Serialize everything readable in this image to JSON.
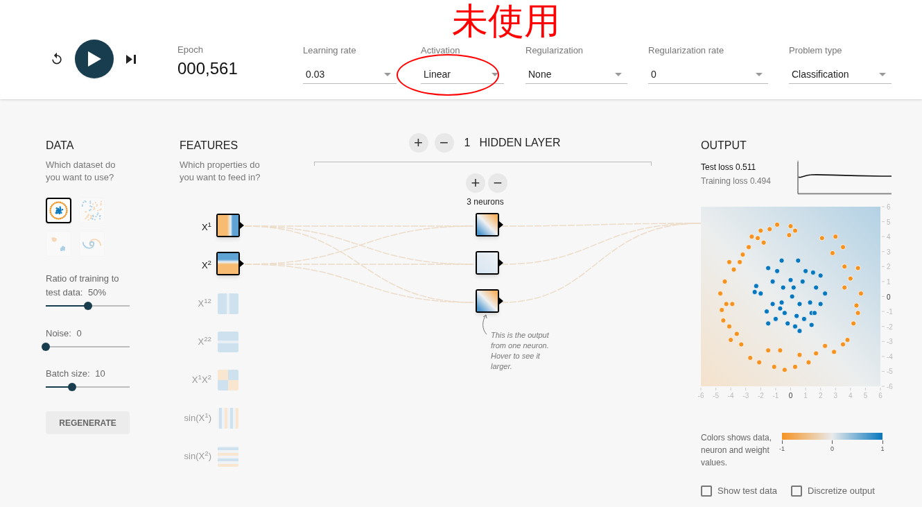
{
  "annotation": {
    "text": "未使用"
  },
  "controls": {
    "buttons": [
      {
        "kind": "reset"
      },
      {
        "kind": "play"
      },
      {
        "kind": "step"
      }
    ]
  },
  "epoch": {
    "label": "Epoch",
    "value": "000,561"
  },
  "dropdowns": [
    {
      "label": "Learning rate",
      "value": "0.03",
      "circled": false
    },
    {
      "label": "Activation",
      "value": "Linear",
      "circled": true
    },
    {
      "label": "Regularization",
      "value": "None",
      "circled": false
    },
    {
      "label": "Regularization rate",
      "value": "0",
      "circled": false
    },
    {
      "label": "Problem type",
      "value": "Classification",
      "circled": false
    }
  ],
  "data": {
    "title": "DATA",
    "description": "Which dataset do you want to use?",
    "datasets": [
      {
        "kind": "circle",
        "selected": true
      },
      {
        "kind": "xor",
        "selected": false
      },
      {
        "kind": "gauss",
        "selected": false
      },
      {
        "kind": "spiral",
        "selected": false
      }
    ],
    "sliders": [
      {
        "label": "Ratio of training to test data:",
        "value": "50%",
        "level": 0.5
      },
      {
        "label": "Noise:",
        "value": "0",
        "level": 0
      },
      {
        "label": "Batch size:",
        "value": "10",
        "level": 0.31
      }
    ],
    "regenerate": "REGENERATE"
  },
  "features": {
    "title": "FEATURES",
    "description": "Which properties do you want to feed in?",
    "items": [
      {
        "label": "X$^{1}$",
        "kind": "x1",
        "active": true
      },
      {
        "label": "X$^{2}$",
        "kind": "x2",
        "active": true
      },
      {
        "label": "X$^{12}$",
        "kind": "x1sq",
        "active": false
      },
      {
        "label": "X$^{22}$",
        "kind": "x2sq",
        "active": false
      },
      {
        "label": "X$^{1}$X$^{2}$",
        "kind": "x1x2",
        "active": false
      },
      {
        "label": "sin(X$^{1}$)",
        "kind": "sin1",
        "active": false
      },
      {
        "label": "sin(X$^{2}$)",
        "kind": "sin2",
        "active": false
      }
    ]
  },
  "hidden_layers": {
    "add": "+",
    "remove": "−",
    "count": "1",
    "title": "HIDDEN LAYER",
    "layer": {
      "add": "+",
      "remove": "−",
      "label": "3 neurons",
      "neurons": [
        {
          "kind": "diagonal"
        },
        {
          "kind": "faint"
        },
        {
          "kind": "diagonal"
        }
      ]
    },
    "callout": "This is the output from one neuron. Hover to see it larger."
  },
  "output": {
    "title": "OUTPUT",
    "test_loss": "Test loss 0.511",
    "training_loss": "Training loss 0.494",
    "chart_data": {
      "type": "scatter",
      "xlim": [
        -6,
        6
      ],
      "ylim": [
        -6,
        6
      ],
      "xticks": [
        {
          "value": -6,
          "label": "-6"
        },
        {
          "value": -5,
          "label": "-5"
        },
        {
          "value": -4,
          "label": "-4"
        },
        {
          "value": -3,
          "label": "-3"
        },
        {
          "value": -2,
          "label": "-2"
        },
        {
          "value": -1,
          "label": "-1"
        },
        {
          "value": 0,
          "label": "0"
        },
        {
          "value": 1,
          "label": "1"
        },
        {
          "value": 2,
          "label": "2"
        },
        {
          "value": 3,
          "label": "3"
        },
        {
          "value": 4,
          "label": "4"
        },
        {
          "value": 5,
          "label": "5"
        },
        {
          "value": 6,
          "label": "6"
        }
      ],
      "yticks": [
        {
          "value": -6,
          "label": "-6"
        },
        {
          "value": -5,
          "label": "-5"
        },
        {
          "value": -4,
          "label": "-4"
        },
        {
          "value": -3,
          "label": "-3"
        },
        {
          "value": -2,
          "label": "-2"
        },
        {
          "value": -1,
          "label": "-1"
        },
        {
          "value": 0,
          "label": "0"
        },
        {
          "value": 1,
          "label": "1"
        },
        {
          "value": 2,
          "label": "2"
        },
        {
          "value": 3,
          "label": "3"
        },
        {
          "value": 4,
          "label": "4"
        },
        {
          "value": 5,
          "label": "5"
        },
        {
          "value": 6,
          "label": "6"
        }
      ],
      "series": [
        {
          "color": "#f59322",
          "x": [
            -4.7,
            -4.6,
            -4.4,
            -4.1,
            -3.8,
            -3.4,
            -3.2,
            -2.8,
            -2.6,
            -2.2,
            -2.0,
            -1.8,
            -1.4,
            -0.9,
            0,
            0.3,
            -0.1,
            0.6,
            2.1,
            3.0,
            2.8,
            3.5,
            3.6,
            4.0,
            4.5,
            4.7,
            4.4,
            4.5,
            4.2,
            3.8,
            3.5,
            2.9,
            2.3,
            1.2,
            0.3,
            -0.4,
            -1.1,
            -2.1,
            -2.7,
            -3.3,
            -3.6,
            -4.0,
            -4.1,
            -4.5,
            -3.9,
            -4.3,
            3.6,
            1.7,
            -1.5,
            -0.7
          ],
          "values": [
            0.2,
            -0.9,
            1.0,
            2.3,
            1.8,
            2.3,
            2.8,
            3.3,
            4.0,
            3.9,
            4.4,
            3.6,
            4.5,
            4.8,
            4.7,
            4.4,
            4.1,
            -3.9,
            3.9,
            4.0,
            2.9,
            3.3,
            2.0,
            1.2,
            1.9,
            0.2,
            -0.6,
            -1.1,
            -1.8,
            -2.9,
            -3.2,
            -3.7,
            -3.3,
            -4.4,
            -4.7,
            -4.9,
            -4.7,
            -4.4,
            -4.1,
            -3.2,
            -2.5,
            -2.9,
            -2.0,
            -1.6,
            -0.5,
            -0.5,
            0.6,
            -3.8,
            -3.6,
            -3.6
          ]
        },
        {
          "color": "#0877bd",
          "x": [
            -0.6,
            0.5,
            -1.5,
            -0.9,
            0.0,
            1.0,
            1.5,
            2.0,
            -2.3,
            -2.0,
            -1.2,
            -0.5,
            0.2,
            0.8,
            1.7,
            2.3,
            -2.4,
            -1.2,
            -0.6,
            0.1,
            0.6,
            1.3,
            2.0,
            -1.6,
            -1.0,
            -0.4,
            0.4,
            0.9,
            1.4,
            1.4,
            0.6,
            -0.2,
            0.3,
            -1.5,
            -0.7,
            1.6
          ],
          "values": [
            2.4,
            2.4,
            1.9,
            1.7,
            1.1,
            1.7,
            1.6,
            1.4,
            0.7,
            0.2,
            1.0,
            0.6,
            0.6,
            1.0,
            0.6,
            0.2,
            0.3,
            -0.5,
            -0.4,
            0.0,
            -0.5,
            -0.4,
            -0.5,
            -1.0,
            -1.5,
            -1.1,
            -1.3,
            -1.5,
            -1.1,
            -1.9,
            -2.3,
            -1.8,
            -2.0,
            -1.8,
            -0.8,
            -1.1
          ]
        }
      ]
    },
    "legend": {
      "text": "Colors shows data, neuron and weight values.",
      "ticks": [
        "-1",
        "0",
        "1"
      ]
    },
    "checkboxes": [
      {
        "label": "Show test data",
        "checked": false
      },
      {
        "label": "Discretize output",
        "checked": false
      }
    ]
  }
}
